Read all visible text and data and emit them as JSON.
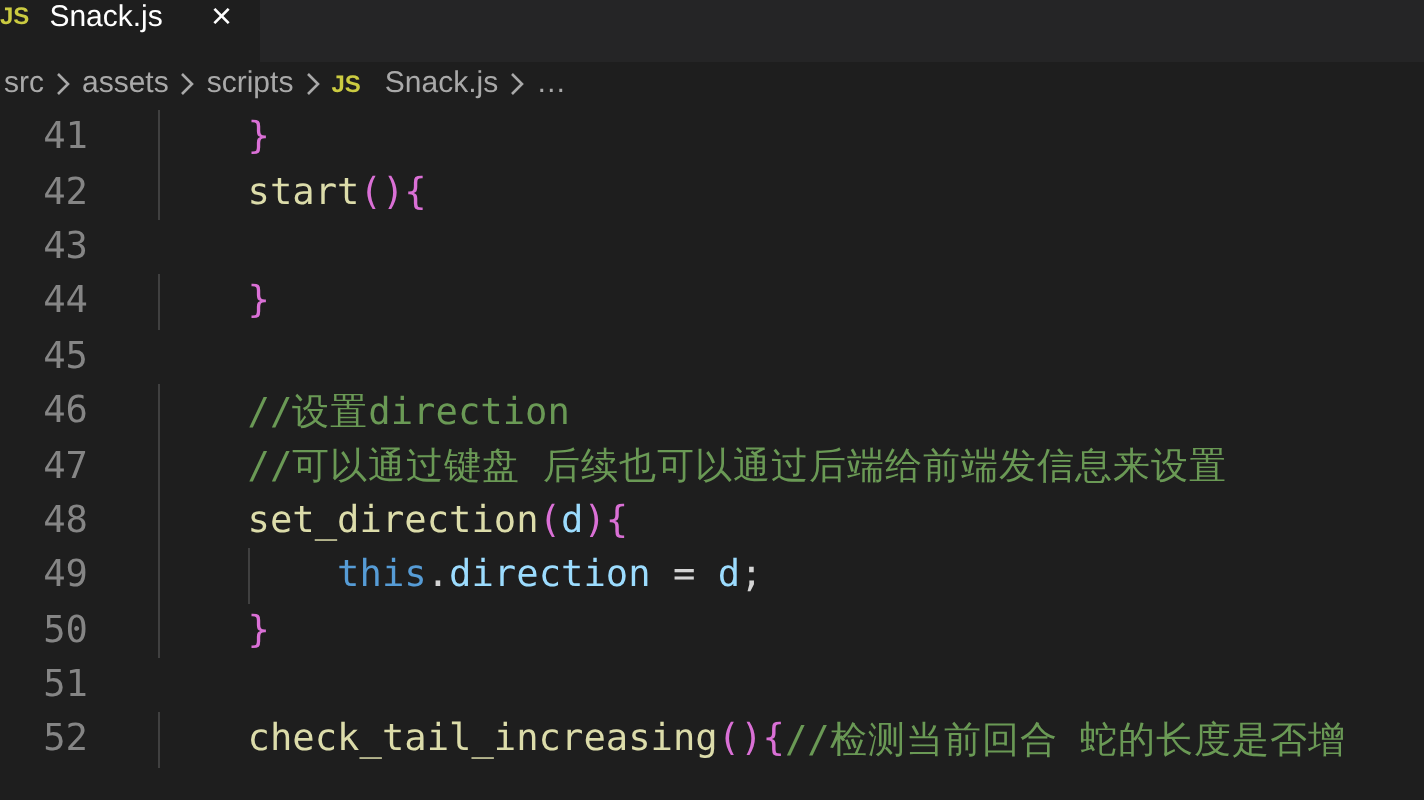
{
  "tabs": [
    {
      "icon_label": "JS",
      "label": "Snack.js",
      "close": "×",
      "selected": true
    }
  ],
  "breadcrumb": [
    {
      "label": "src"
    },
    {
      "label": "assets"
    },
    {
      "label": "scripts"
    },
    {
      "icon_label": "JS",
      "label": "Snack.js"
    },
    {
      "label": "…"
    }
  ],
  "editor": {
    "lines": [
      {
        "number": "41",
        "tokens": [
          {
            "kind": "bracket",
            "text": "    }"
          }
        ]
      },
      {
        "number": "42",
        "tokens": [
          {
            "kind": "function",
            "text": "    start"
          },
          {
            "kind": "bracket",
            "text": "(){"
          }
        ]
      },
      {
        "number": "43"
      },
      {
        "number": "44",
        "tokens": [
          {
            "kind": "bracket",
            "text": "    }"
          }
        ]
      },
      {
        "number": "45"
      },
      {
        "number": "46",
        "tokens": [
          {
            "kind": "comment",
            "text": "    //设置direction"
          }
        ]
      },
      {
        "number": "47",
        "tokens": [
          {
            "kind": "comment",
            "text": "    //可以通过键盘 后续也可以通过后端给前端发信息来设置"
          }
        ]
      },
      {
        "number": "48",
        "tokens": [
          {
            "kind": "function",
            "text": "    set_direction"
          },
          {
            "kind": "bracket",
            "text": "("
          },
          {
            "kind": "variable",
            "text": "d"
          },
          {
            "kind": "bracket",
            "text": "){"
          }
        ]
      },
      {
        "number": "49",
        "tokens": [
          {
            "kind": "keyword",
            "text": "        this"
          },
          {
            "kind": "plain",
            "text": "."
          },
          {
            "kind": "variable",
            "text": "direction"
          },
          {
            "kind": "plain",
            "text": " = "
          },
          {
            "kind": "variable",
            "text": "d"
          },
          {
            "kind": "plain",
            "text": ";"
          }
        ]
      },
      {
        "number": "50",
        "tokens": [
          {
            "kind": "bracket",
            "text": "    }"
          }
        ]
      },
      {
        "number": "51"
      },
      {
        "number": "52",
        "tokens": [
          {
            "kind": "function",
            "text": "    check_tail_increasing"
          },
          {
            "kind": "bracket",
            "text": "(){"
          },
          {
            "kind": "comment",
            "text": "//检测当前回合 蛇的长度是否增"
          }
        ]
      }
    ]
  }
}
